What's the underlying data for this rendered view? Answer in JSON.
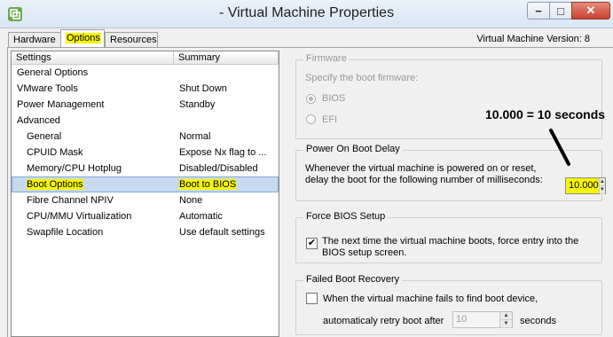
{
  "window": {
    "title": "- Virtual Machine Properties",
    "min_glyph": "−",
    "max_glyph": "□",
    "close_glyph": "✕",
    "icon": "vm-app-icon"
  },
  "tabs": [
    {
      "label": "Hardware"
    },
    {
      "label": "Options",
      "selected": true,
      "highlight": "#f6f600"
    },
    {
      "label": "Resources"
    }
  ],
  "vm_version": "Virtual Machine Version: 8",
  "settings_list": {
    "headers": [
      "Settings",
      "Summary"
    ],
    "rows": [
      {
        "name": "General Options",
        "summary": "",
        "indent": 0
      },
      {
        "name": "VMware Tools",
        "summary": "Shut Down",
        "indent": 0
      },
      {
        "name": "Power Management",
        "summary": "Standby",
        "indent": 0
      },
      {
        "name": "Advanced",
        "summary": "",
        "indent": 0
      },
      {
        "name": "General",
        "summary": "Normal",
        "indent": 1
      },
      {
        "name": "CPUID Mask",
        "summary": "Expose Nx flag to ...",
        "indent": 1
      },
      {
        "name": "Memory/CPU Hotplug",
        "summary": "Disabled/Disabled",
        "indent": 1
      },
      {
        "name": "Boot Options",
        "summary": "Boot to BIOS",
        "indent": 1,
        "selected": true
      },
      {
        "name": "Fibre Channel NPIV",
        "summary": "None",
        "indent": 1
      },
      {
        "name": "CPU/MMU Virtualization",
        "summary": "Automatic",
        "indent": 1
      },
      {
        "name": "Swapfile Location",
        "summary": "Use default settings",
        "indent": 1
      }
    ]
  },
  "firmware": {
    "legend": "Firmware",
    "description": "Specify the boot firmware:",
    "options": [
      "BIOS",
      "EFI"
    ],
    "selected": "BIOS"
  },
  "power_on_boot_delay": {
    "legend": "Power On Boot Delay",
    "line1": "Whenever the virtual machine is powered on or reset,",
    "line2": "delay the boot for the following number of milliseconds:",
    "value": "10.000"
  },
  "force_bios": {
    "legend": "Force BIOS Setup",
    "checked": true,
    "check_glyph": "✔",
    "line1": "The next time the virtual machine boots, force entry into the",
    "line2": "BIOS setup screen."
  },
  "failed_boot_recovery": {
    "legend": "Failed Boot Recovery",
    "checked": false,
    "line1": "When the virtual machine fails to find boot device,",
    "line2": "automaticaly retry boot after",
    "retry_value": "10",
    "unit": "seconds"
  },
  "spinner_glyphs": {
    "up": "▲",
    "down": "▼"
  },
  "annotation": {
    "text": "10.000 = 10 seconds"
  },
  "colors": {
    "highlight": "#f6f600",
    "selection": "#c7daf0",
    "close_button": "#c9412f"
  }
}
